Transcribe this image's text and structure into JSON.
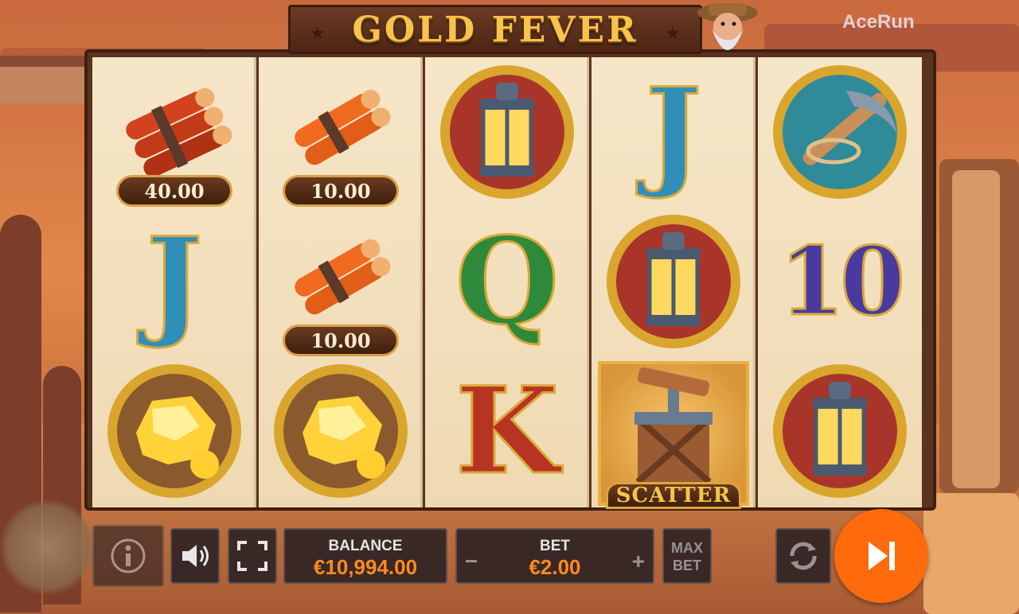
{
  "game": {
    "title": "GOLD FEVER",
    "provider_logo": "AceRun"
  },
  "colors": {
    "accent": "#ff6a0c",
    "value_text": "#ff8a1e",
    "gold": "#f6c44a",
    "frame_wood": "#5a3220"
  },
  "reels": [
    {
      "symbols": [
        {
          "name": "dynamite-red",
          "win": "40.00"
        },
        {
          "name": "J"
        },
        {
          "name": "gold-nugget"
        }
      ]
    },
    {
      "symbols": [
        {
          "name": "dynamite-orange",
          "win": "10.00"
        },
        {
          "name": "dynamite-orange",
          "win": "10.00"
        },
        {
          "name": "gold-nugget"
        }
      ]
    },
    {
      "symbols": [
        {
          "name": "lantern"
        },
        {
          "name": "Q"
        },
        {
          "name": "K"
        }
      ]
    },
    {
      "symbols": [
        {
          "name": "J"
        },
        {
          "name": "lantern"
        },
        {
          "name": "scatter-detonator",
          "label": "SCATTER"
        }
      ]
    },
    {
      "symbols": [
        {
          "name": "pickaxe"
        },
        {
          "name": "10"
        },
        {
          "name": "lantern"
        }
      ]
    }
  ],
  "controls": {
    "info_icon": "info-icon",
    "sound_icon": "speaker-icon",
    "fullscreen_icon": "fullscreen-icon",
    "balance_label": "BALANCE",
    "balance_value": "€10,994.00",
    "bet_label": "BET",
    "bet_value": "€2.00",
    "bet_minus": "−",
    "bet_plus": "+",
    "maxbet_line1": "MAX",
    "maxbet_line2": "BET",
    "autoplay_icon": "autoplay-icon",
    "spin_icon": "skip-forward-icon"
  }
}
